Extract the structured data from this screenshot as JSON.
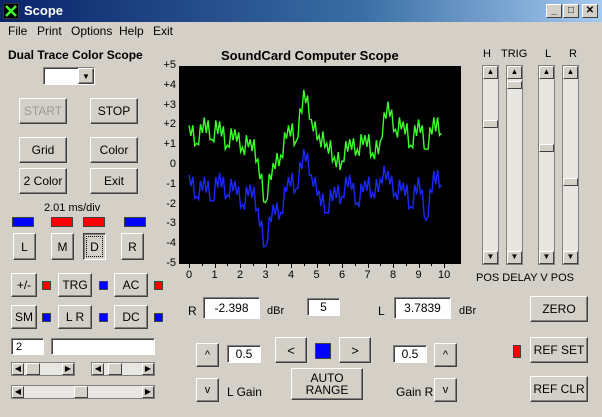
{
  "window": {
    "title": "Scope",
    "min": "_",
    "max": "□",
    "close": "✕"
  },
  "menu": [
    "File",
    "Print",
    "Options",
    "Help",
    "Exit"
  ],
  "app_title": "Dual Trace Color Scope",
  "buttons": {
    "start": "START",
    "stop": "STOP",
    "grid": "Grid",
    "color": "Color",
    "two_color": "2 Color",
    "exit": "Exit",
    "l": "L",
    "m": "M",
    "d": "D",
    "r": "R",
    "plusminus": "+/-",
    "trg": "TRG",
    "ac": "AC",
    "sm": "SM",
    "lr": "L  R",
    "dc": "DC",
    "zero": "ZERO",
    "ref_set": "REF SET",
    "ref_clr": "REF CLR",
    "auto_range_1": "AUTO",
    "auto_range_2": "RANGE",
    "left": "<",
    "right": ">",
    "up": "^",
    "down": "v"
  },
  "timebase": "2.01 ms/div",
  "scope_title": "SoundCard Computer Scope",
  "slider_labels": {
    "h": "H",
    "trg": "TRIG",
    "l": "L",
    "r": "R",
    "bottom": "POS DELAY  V POS"
  },
  "readouts": {
    "r_label": "R",
    "r_value": "-2.398",
    "r_unit": "dBr",
    "center_value": "5",
    "l_label": "L",
    "l_value": "3.7839",
    "l_unit": "dBr",
    "l_gain_value": "0.5",
    "l_gain_label": "L Gain",
    "r_gain_value": "0.5",
    "r_gain_label": "Gain R",
    "small_field": "2"
  },
  "colors": {
    "green_trace": "#3cff2a",
    "blue_trace": "#1a28ff",
    "ind_blue": "#0000ff",
    "ind_red": "#ff0000"
  },
  "chart_data": {
    "type": "line",
    "title": "SoundCard Computer Scope",
    "xlabel": "",
    "ylabel": "",
    "xlim": [
      0,
      10
    ],
    "ylim": [
      -5,
      5
    ],
    "x_ticks": [
      "0",
      "1",
      "2",
      "3",
      "4",
      "5",
      "6",
      "7",
      "8",
      "9",
      "10"
    ],
    "y_ticks": [
      "+5",
      "+4",
      "+3",
      "+2",
      "+1",
      "0",
      "-1",
      "-2",
      "-3",
      "-4",
      "-5"
    ],
    "grid": false,
    "series": [
      {
        "color": "#3cff2a",
        "x": [
          0,
          0.3,
          0.6,
          0.9,
          1.2,
          1.5,
          1.8,
          2.1,
          2.4,
          2.7,
          3.0,
          3.3,
          3.6,
          3.9,
          4.2,
          4.5,
          4.8,
          5.1,
          5.4,
          5.7,
          6.0,
          6.3,
          6.6,
          6.9,
          7.2,
          7.5,
          7.8,
          8.1,
          8.4,
          8.7,
          9.0,
          9.3,
          9.6,
          9.9
        ],
        "values": [
          2.0,
          1.1,
          2.4,
          1.3,
          2.2,
          1.0,
          1.8,
          0.9,
          1.3,
          0.3,
          -1.9,
          0.1,
          0.5,
          2.0,
          1.2,
          3.8,
          2.3,
          1.5,
          1.1,
          0.4,
          0.2,
          1.3,
          0.8,
          1.5,
          0.6,
          1.2,
          3.2,
          1.8,
          2.2,
          1.0,
          2.3,
          0.8,
          2.4,
          1.6
        ]
      },
      {
        "color": "#1a28ff",
        "x": [
          0,
          0.3,
          0.6,
          0.9,
          1.2,
          1.5,
          1.8,
          2.1,
          2.4,
          2.7,
          3.0,
          3.3,
          3.6,
          3.9,
          4.2,
          4.5,
          4.8,
          5.1,
          5.4,
          5.7,
          6.0,
          6.3,
          6.6,
          6.9,
          7.2,
          7.5,
          7.8,
          8.1,
          8.4,
          8.7,
          9.0,
          9.3,
          9.6,
          9.9
        ],
        "values": [
          -0.5,
          -1.6,
          -0.6,
          -1.8,
          -0.4,
          -1.5,
          -0.8,
          -2.0,
          -1.0,
          -2.2,
          -4.1,
          -2.0,
          -2.4,
          -0.6,
          -1.2,
          0.8,
          -0.5,
          -1.3,
          -2.4,
          -1.1,
          -1.6,
          -0.5,
          -1.9,
          -0.8,
          -1.4,
          -0.7,
          -0.3,
          -1.4,
          -0.9,
          -2.1,
          -0.6,
          -2.8,
          -0.3,
          -1.0
        ]
      }
    ]
  }
}
